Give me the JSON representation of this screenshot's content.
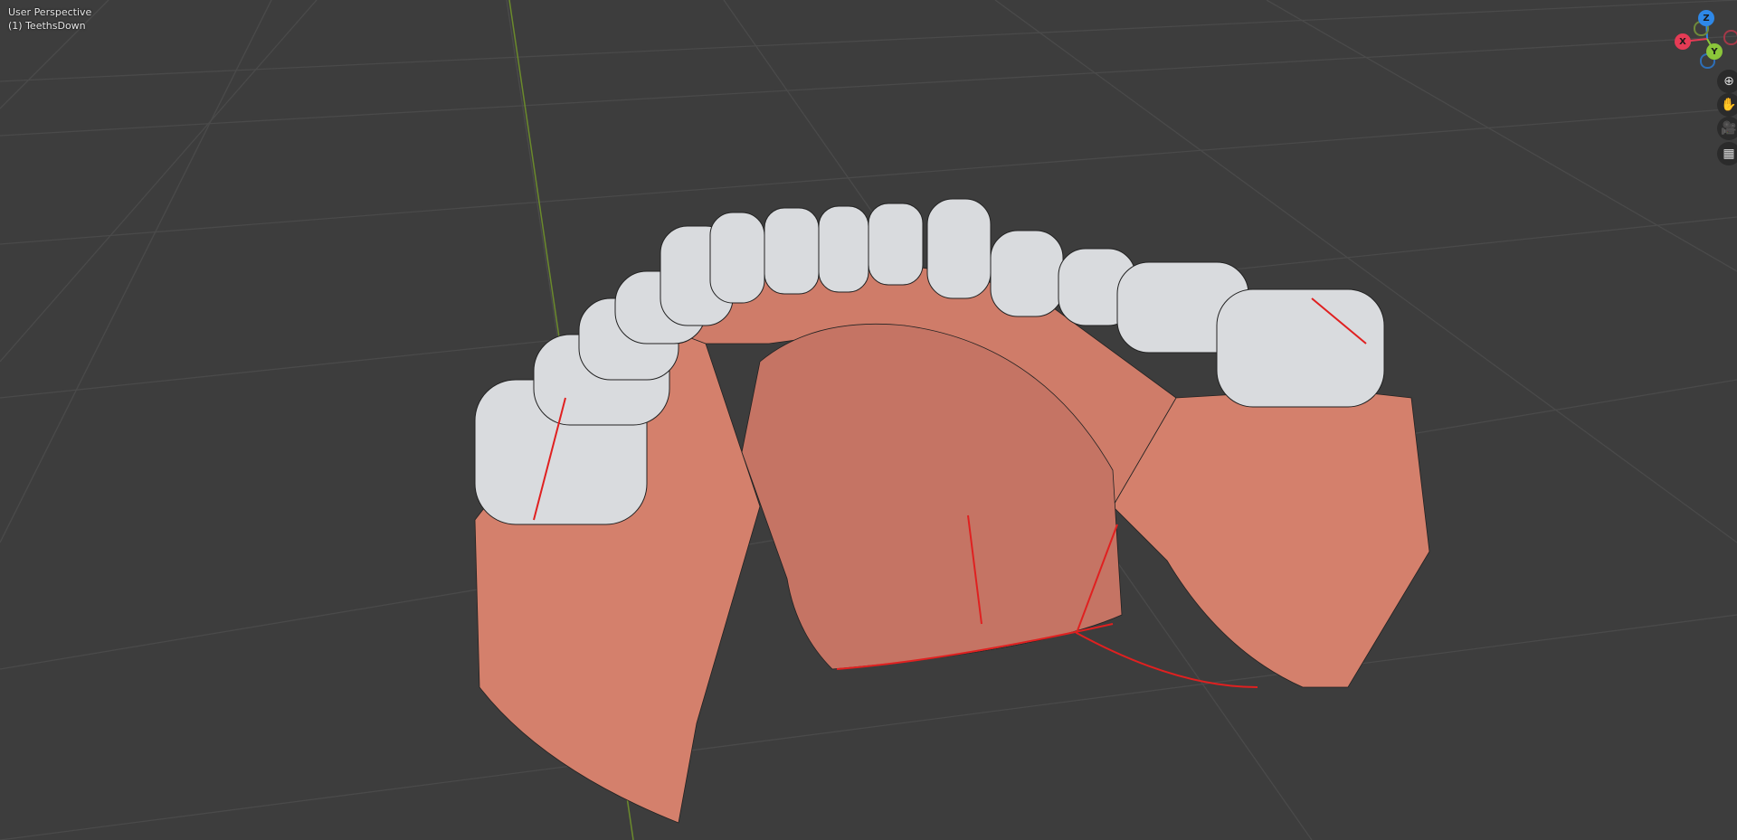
{
  "viewport": {
    "view_name": "User Perspective",
    "object_label": "(1) TeethsDown",
    "gizmo": {
      "x_label": "X",
      "y_label": "Y",
      "z_label": "Z",
      "x_color": "#e53b55",
      "y_color": "#8bc63a",
      "z_color": "#2e88e8"
    },
    "nav_buttons": [
      {
        "icon": "zoom-icon",
        "glyph": "⊕"
      },
      {
        "icon": "hand-pan-icon",
        "glyph": "✋"
      },
      {
        "icon": "camera-icon",
        "glyph": "🎥"
      },
      {
        "icon": "grid-ortho-icon",
        "glyph": "▦"
      }
    ],
    "colors": {
      "background": "#3d3d3d",
      "gum": "#d88a76",
      "tooth": "#d9dbde",
      "seam": "#e02020"
    }
  }
}
